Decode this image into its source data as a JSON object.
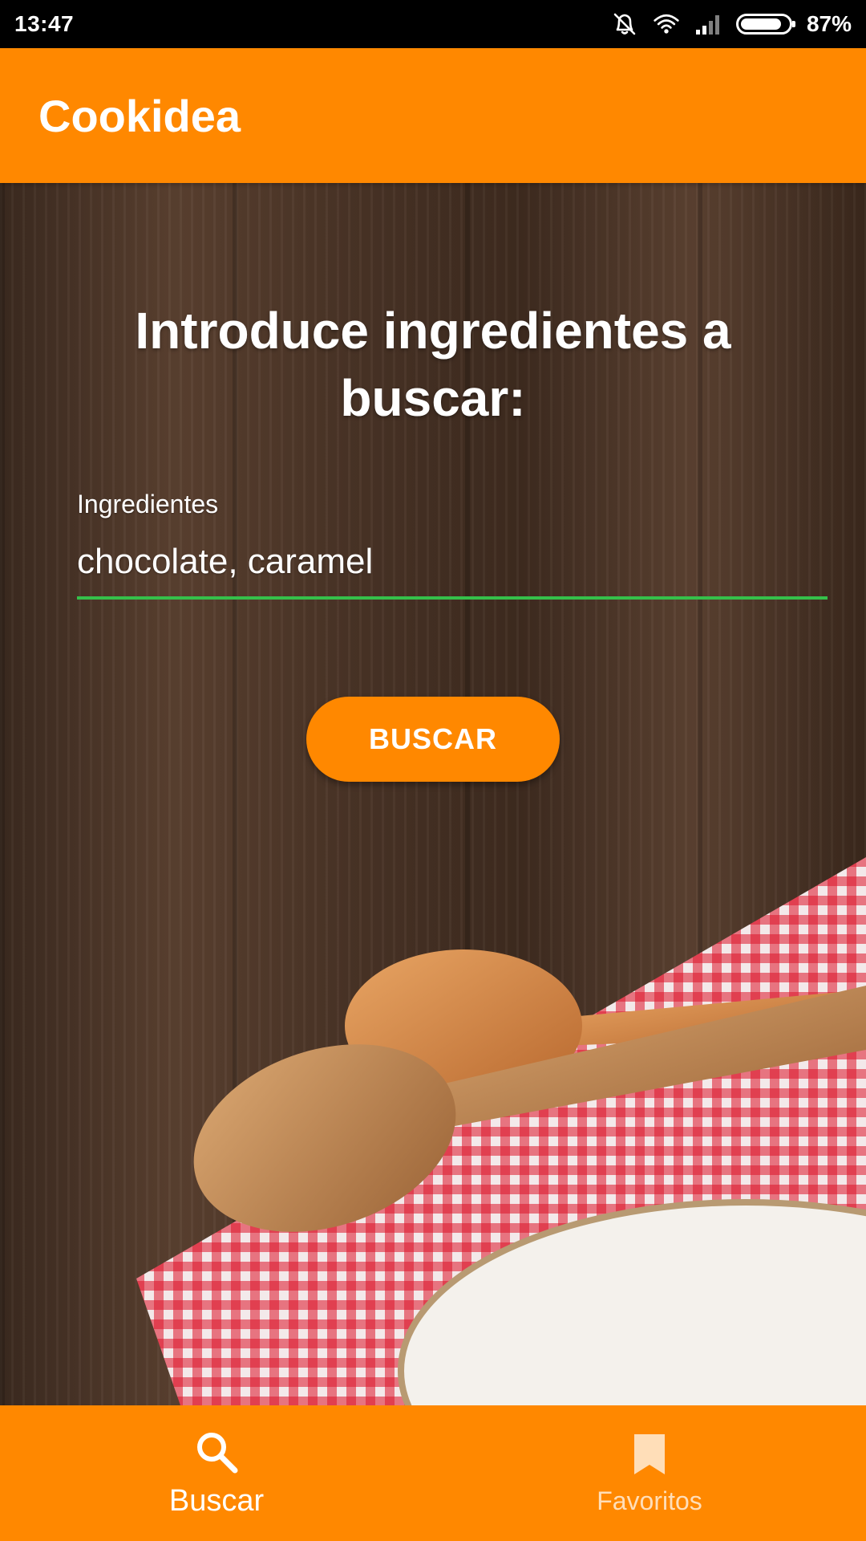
{
  "status_bar": {
    "time": "13:47",
    "battery_text": "87%",
    "battery_level": 0.87,
    "icons": [
      "vibrate-off-icon",
      "wifi-icon",
      "signal-icon",
      "battery-icon"
    ]
  },
  "app_bar": {
    "title": "Cookidea"
  },
  "main": {
    "headline": "Introduce ingredientes a buscar:",
    "ingredients_field": {
      "label": "Ingredientes",
      "value": "chocolate, caramel"
    },
    "search_button_label": "BUSCAR"
  },
  "bottom_nav": {
    "items": [
      {
        "label": "Buscar",
        "icon": "search-icon",
        "active": true
      },
      {
        "label": "Favoritos",
        "icon": "bookmark-icon",
        "active": false
      }
    ]
  },
  "colors": {
    "accent": "#ff8800",
    "field_underline": "#35c04a",
    "status_bar": "#000000"
  }
}
